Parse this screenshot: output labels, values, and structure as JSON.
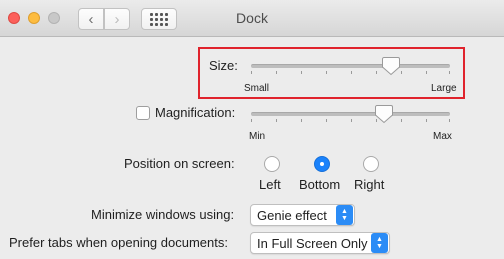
{
  "window": {
    "title": "Dock",
    "nav": {
      "back_icon": "‹",
      "forward_icon": "›"
    }
  },
  "size": {
    "label": "Size:",
    "min_label": "Small",
    "max_label": "Large",
    "value_fraction": 0.7
  },
  "magnification": {
    "checkbox_checked": false,
    "label": "Magnification:",
    "min_label": "Min",
    "max_label": "Max",
    "value_fraction": 0.67
  },
  "position": {
    "label": "Position on screen:",
    "options": [
      "Left",
      "Bottom",
      "Right"
    ],
    "selected": "Bottom"
  },
  "minimize": {
    "label": "Minimize windows using:",
    "value": "Genie effect"
  },
  "prefer_tabs": {
    "label": "Prefer tabs when opening documents:",
    "value": "In Full Screen Only"
  },
  "colors": {
    "accent": "#1a82fb",
    "highlight": "#e0232c"
  }
}
